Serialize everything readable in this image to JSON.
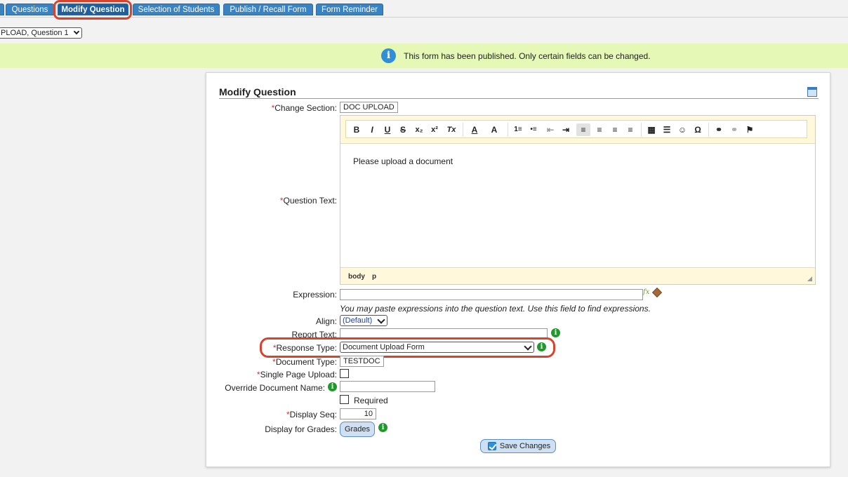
{
  "tabs": [
    {
      "label": "Questions"
    },
    {
      "label": "Modify Question"
    },
    {
      "label": "Selection of Students"
    },
    {
      "label": "Publish / Recall Form"
    },
    {
      "label": "Form Reminder"
    }
  ],
  "section_select": {
    "value": "PLOAD, Question 1"
  },
  "notice": {
    "message": "This form has been published. Only certain fields can be changed.",
    "icon": "info-icon"
  },
  "card": {
    "title": "Modify Question",
    "change_section": {
      "label": "Change Section:",
      "value": "DOC UPLOAD"
    },
    "question_text": {
      "label": "Question Text:",
      "content": "Please upload a document",
      "footer_path": [
        "body",
        "p"
      ],
      "toolbar": [
        "B",
        "I",
        "U",
        "S",
        "x₂",
        "x²",
        "Tx",
        "A",
        "A",
        "1≡",
        "•≡",
        "⇤",
        "⇥",
        "≡",
        "≡",
        "≡",
        "≡",
        "▦",
        "☰",
        "☺",
        "Ω",
        "⚭",
        "⚭",
        "⚑"
      ]
    },
    "expression": {
      "label": "Expression:",
      "value": "",
      "hint": "You may paste expressions into the question text. Use this field to find expressions.",
      "fx": "fx"
    },
    "align": {
      "label": "Align:",
      "value": "(Default)"
    },
    "report_text": {
      "label": "Report Text:",
      "value": ""
    },
    "response_type": {
      "label": "Response Type:",
      "value": "Document Upload Form"
    },
    "document_type": {
      "label": "Document Type:",
      "value": "TESTDOC"
    },
    "single_page_upload": {
      "label": "Single Page Upload:",
      "checked": false
    },
    "override_document_name": {
      "label": "Override Document Name:",
      "value": ""
    },
    "required": {
      "label": "Required",
      "checked": false
    },
    "display_seq": {
      "label": "Display Seq:",
      "value": "10"
    },
    "display_for_grades": {
      "label": "Display for Grades:",
      "button": "Grades"
    },
    "save_button": "Save Changes",
    "required_marker": "*",
    "info_glyph": "i"
  },
  "colors": {
    "tab": "#3a83c3",
    "notice_bg": "#e5f8b6",
    "highlight": "#d9432e",
    "required": "#d9342b",
    "info_green": "#1d9a2a"
  }
}
